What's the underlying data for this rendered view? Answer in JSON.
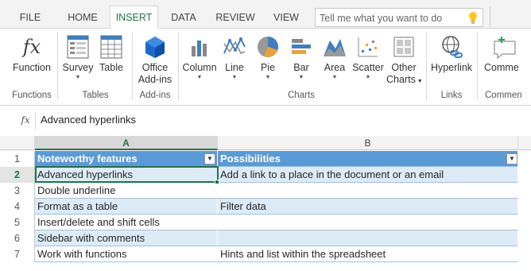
{
  "tabs": [
    "FILE",
    "HOME",
    "INSERT",
    "DATA",
    "REVIEW",
    "VIEW"
  ],
  "active_tab": "INSERT",
  "tellme": {
    "placeholder": "Tell me what you want to do"
  },
  "ribbon": {
    "function": {
      "label": "Function"
    },
    "survey": {
      "label": "Survey"
    },
    "table": {
      "label": "Table"
    },
    "office_addins": {
      "label1": "Office",
      "label2": "Add-ins"
    },
    "column": {
      "label": "Column"
    },
    "line": {
      "label": "Line"
    },
    "pie": {
      "label": "Pie"
    },
    "bar": {
      "label": "Bar"
    },
    "area": {
      "label": "Area"
    },
    "scatter": {
      "label": "Scatter"
    },
    "other_charts": {
      "label1": "Other",
      "label2": "Charts"
    },
    "hyperlink": {
      "label": "Hyperlink"
    },
    "comment": {
      "label": "Comme"
    },
    "groups": {
      "functions": "Functions",
      "tables": "Tables",
      "addins": "Add-ins",
      "charts": "Charts",
      "links": "Links",
      "comments": "Commen"
    }
  },
  "formula_bar": {
    "fx": "fx",
    "value": "Advanced hyperlinks"
  },
  "sheet": {
    "columns": [
      "A",
      "B"
    ],
    "rows": [
      {
        "n": "1",
        "a": "Noteworthy features",
        "b": "Possibilities"
      },
      {
        "n": "2",
        "a": "Advanced hyperlinks",
        "b": "Add a link to a place in the document or an email"
      },
      {
        "n": "3",
        "a": "Double underline",
        "b": ""
      },
      {
        "n": "4",
        "a": "Format as a table",
        "b": "Filter data"
      },
      {
        "n": "5",
        "a": "Insert/delete and shift cells",
        "b": ""
      },
      {
        "n": "6",
        "a": "Sidebar with comments",
        "b": ""
      },
      {
        "n": "7",
        "a": "Work with functions",
        "b": "Hints and list within the spreadsheet"
      }
    ]
  },
  "colors": {
    "excel_green": "#217346",
    "table_header": "#5b9bd5",
    "table_band": "#ddebf7"
  }
}
